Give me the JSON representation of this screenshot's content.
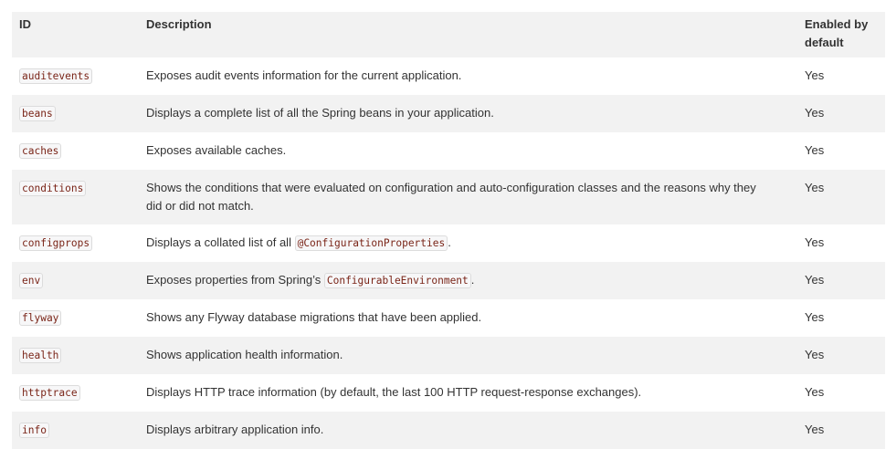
{
  "table": {
    "headers": {
      "id": "ID",
      "description": "Description",
      "enabled": "Enabled by default"
    },
    "rows": [
      {
        "id": "auditevents",
        "description": "Exposes audit events information for the current application.",
        "enabled": "Yes"
      },
      {
        "id": "beans",
        "description": "Displays a complete list of all the Spring beans in your application.",
        "enabled": "Yes"
      },
      {
        "id": "caches",
        "description": "Exposes available caches.",
        "enabled": "Yes"
      },
      {
        "id": "conditions",
        "description": "Shows the conditions that were evaluated on configuration and auto-configuration classes and the reasons why they did or did not match.",
        "enabled": "Yes"
      },
      {
        "id": "configprops",
        "description_prefix": "Displays a collated list of all ",
        "description_code": "@ConfigurationProperties",
        "description_suffix": ".",
        "enabled": "Yes"
      },
      {
        "id": "env",
        "description_prefix": "Exposes properties from Spring’s ",
        "description_code": "ConfigurableEnvironment",
        "description_suffix": ".",
        "enabled": "Yes"
      },
      {
        "id": "flyway",
        "description": "Shows any Flyway database migrations that have been applied.",
        "enabled": "Yes"
      },
      {
        "id": "health",
        "description": "Shows application health information.",
        "enabled": "Yes"
      },
      {
        "id": "httptrace",
        "description": "Displays HTTP trace information (by default, the last 100 HTTP request-response exchanges).",
        "enabled": "Yes"
      },
      {
        "id": "info",
        "description": "Displays arbitrary application info.",
        "enabled": "Yes"
      }
    ]
  }
}
